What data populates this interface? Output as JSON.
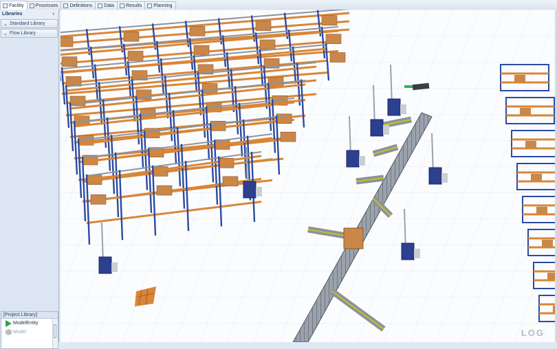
{
  "tabs": [
    {
      "label": "Facility",
      "active": true
    },
    {
      "label": "Processes",
      "active": false
    },
    {
      "label": "Definitions",
      "active": false
    },
    {
      "label": "Data",
      "active": false
    },
    {
      "label": "Results",
      "active": false
    },
    {
      "label": "Planning",
      "active": false
    }
  ],
  "sidebar": {
    "title": "Libraries",
    "collapse_glyph": "‹",
    "libraries": [
      {
        "label": "Standard Library",
        "glyph": "⌄"
      },
      {
        "label": "Flow Library",
        "glyph": "⌄"
      }
    ]
  },
  "project_library": {
    "title": "[Project Library]",
    "items": [
      {
        "label": "ModelEntity",
        "icon": "green-triangle-icon"
      },
      {
        "label": "Model",
        "icon": "grey-hexagon-icon"
      }
    ]
  },
  "watermark": "LOG",
  "colors": {
    "rack_blue": "#2b4aa0",
    "shelf_orange": "#d98636",
    "box": "#c9874a",
    "conveyor": "#6f7780",
    "accent_yellow": "#c8c024"
  }
}
